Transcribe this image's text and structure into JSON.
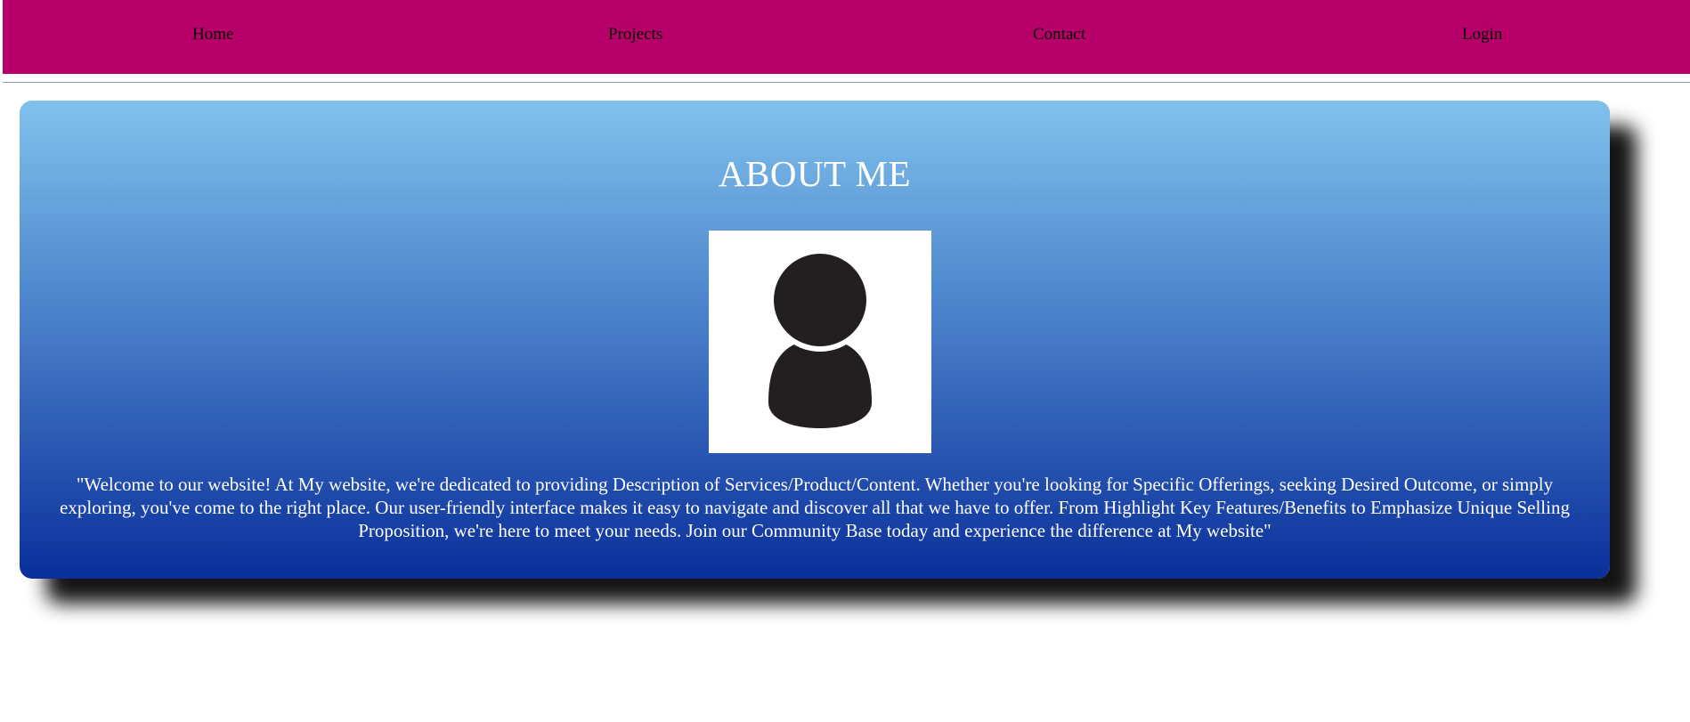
{
  "nav": {
    "home": "Home",
    "projects": "Projects",
    "contact": "Contact",
    "login": "Login"
  },
  "about": {
    "title": "ABOUT ME",
    "avatar_icon": "user-avatar-icon",
    "description": "\"Welcome to our website! At My website, we're dedicated to providing Description of Services/Product/Content. Whether you're looking for Specific Offerings, seeking Desired Outcome, or simply exploring, you've come to the right place. Our user-friendly interface makes it easy to navigate and discover all that we have to offer. From Highlight Key Features/Benefits to Emphasize Unique Selling Proposition, we're here to meet your needs. Join our Community Base today and experience the difference at My website\""
  },
  "colors": {
    "nav_background": "#b8006a",
    "card_gradient_top": "#80c2ec",
    "card_gradient_bottom": "#0a2f9b",
    "text": "#ffffff"
  }
}
